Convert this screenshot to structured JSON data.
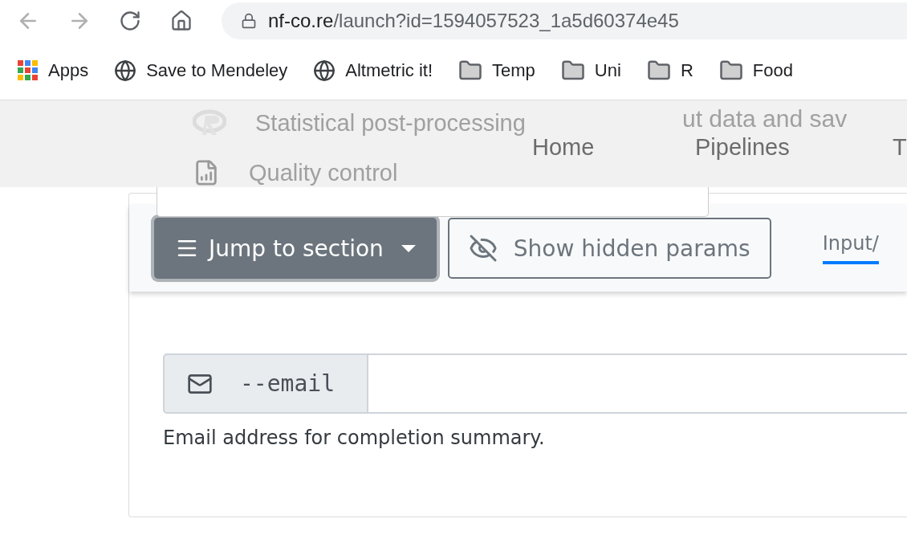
{
  "browser": {
    "url_host": "nf-co.re",
    "url_path": "/launch?id=1594057523_1a5d60374e45",
    "bookmarks": [
      {
        "kind": "apps",
        "label": "Apps"
      },
      {
        "kind": "globe",
        "label": "Save to Mendeley"
      },
      {
        "kind": "globe",
        "label": "Altmetric it!"
      },
      {
        "kind": "folder",
        "label": "Temp"
      },
      {
        "kind": "folder",
        "label": "Uni"
      },
      {
        "kind": "folder",
        "label": "R"
      },
      {
        "kind": "folder",
        "label": "Food"
      }
    ]
  },
  "navbar": {
    "items": [
      "Home",
      "Pipelines",
      "T"
    ],
    "background_text": "ut data and sav"
  },
  "dropdown": {
    "items": [
      {
        "kind": "r",
        "label": "Statistical post-processing"
      },
      {
        "kind": "report",
        "label": "Quality control"
      }
    ]
  },
  "toolbar": {
    "jump_button": "Jump to section",
    "hidden_button": "Show hidden params",
    "tabs": [
      {
        "label": "Input/",
        "selected": true
      }
    ]
  },
  "field": {
    "name": "--email",
    "help": "Email address for completion summary."
  }
}
